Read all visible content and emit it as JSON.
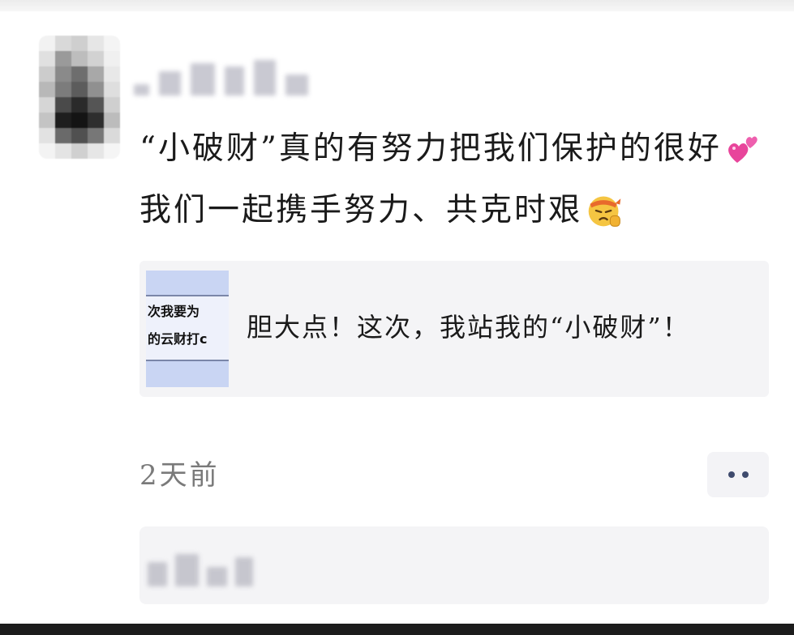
{
  "post": {
    "author": {
      "name_hidden": true
    },
    "text_line1": "“小破财”真的有努力把我们保护的很好",
    "text_line2": "我们一起携手努力、共克时艰",
    "emoji_line1": "two-hearts",
    "emoji_line2": "fighting-face"
  },
  "quote": {
    "thumb_line1": "次我要为",
    "thumb_line2": "的云财打c",
    "text": "胆大点！这次，我站我的“小破财”！"
  },
  "meta": {
    "timestamp": "2天前"
  },
  "colors": {
    "text": "#1a1a1a",
    "muted": "#7a7a7a",
    "card_bg": "#f4f4f6",
    "more_dots": "#3e4a6d",
    "heart_pink": "#e8459b",
    "emoji_yellow": "#f5c542"
  },
  "icons": {
    "more": "more-dots-icon",
    "hearts": "two-hearts-icon",
    "face": "fighting-face-icon"
  }
}
